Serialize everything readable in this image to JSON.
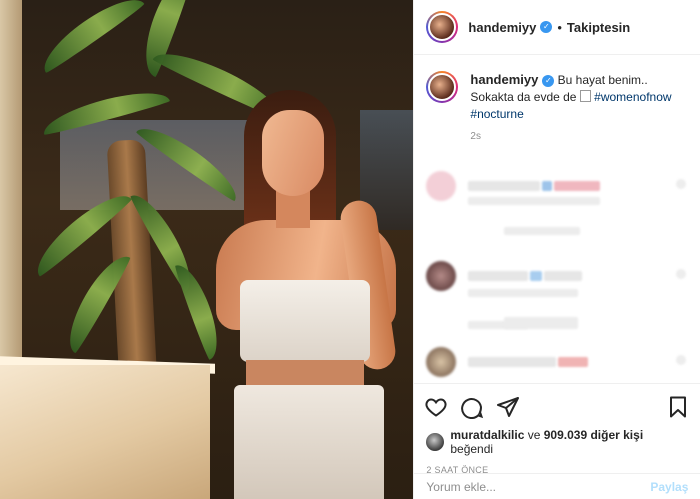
{
  "post": {
    "author": "handemiyy",
    "verified": true,
    "separator": "•",
    "follow_label": "Takiptesin"
  },
  "caption": {
    "username": "handemiyy",
    "line1": "Bu hayat benim..",
    "line2": "Sokakta da evde de",
    "hashtag1": "#womenofnow",
    "hashtag2": "#nocturne",
    "time": "2s"
  },
  "likes": {
    "first_liker": "muratdalkilic",
    "joiner": "ve",
    "count_text": "909.039 diğer kişi",
    "suffix": "beğendi"
  },
  "posted_ago": "2 SAAT ÖNCE",
  "comment_box": {
    "placeholder": "Yorum ekle...",
    "share_label": "Paylaş"
  },
  "icons": [
    "heart-icon",
    "comment-icon",
    "share-icon",
    "bookmark-icon",
    "verified-badge-icon"
  ],
  "colors": {
    "link": "#00376b",
    "verified": "#3897f0",
    "share_disabled": "#b2dffc",
    "muted": "#8e8e8e"
  }
}
